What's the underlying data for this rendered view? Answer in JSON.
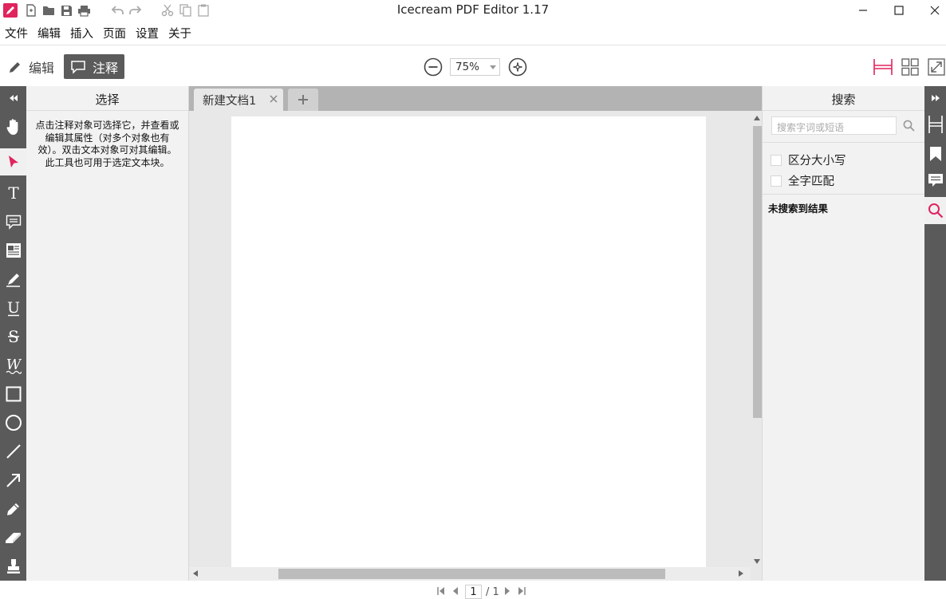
{
  "app": {
    "title": "Icecream PDF Editor 1.17",
    "accent": "#e0245e"
  },
  "menu": [
    "文件",
    "编辑",
    "插入",
    "页面",
    "设置",
    "关于"
  ],
  "toolbar": {
    "edit_label": "编辑",
    "annotate_label": "注释",
    "zoom_value": "75%"
  },
  "left_panel": {
    "title": "选择",
    "description_lines": [
      "点击注释对象可选择它，并查看或",
      "编辑其属性（对多个对象也有",
      "效）。双击文本对象可对其编辑。",
      "此工具也可用于选定文本块。"
    ]
  },
  "tabs": [
    {
      "label": "新建文档1"
    }
  ],
  "right_panel": {
    "title": "搜索",
    "search_placeholder": "搜索字词或短语",
    "options": [
      "区分大小写",
      "全字匹配"
    ],
    "no_results": "未搜索到结果"
  },
  "page_nav": {
    "current": "1",
    "total": "/ 1"
  },
  "icons": {
    "left_tools": [
      "hand-icon",
      "select-arrow-icon",
      "text-icon",
      "comment-icon",
      "textbox-icon",
      "highlighter-icon",
      "underline-icon",
      "strikethrough-icon",
      "squiggly-icon",
      "rectangle-icon",
      "ellipse-icon",
      "line-icon",
      "arrow-icon",
      "pencil-icon",
      "eraser-icon",
      "stamp-icon"
    ],
    "right_tools": [
      "expand-icon",
      "page-thumbnails-icon",
      "bookmark-icon",
      "annotations-list-icon",
      "search-icon"
    ]
  }
}
